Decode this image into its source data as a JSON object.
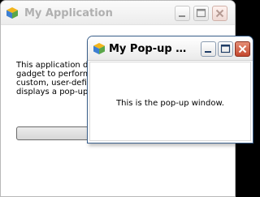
{
  "main_window": {
    "title": "My Application",
    "description": "This application de\ngadget to perform\ncustom, user-defin\ndisplays a pop-up",
    "controls": {
      "minimize": "minimize-icon",
      "maximize": "maximize-icon",
      "close": "close-icon"
    },
    "icon": "app-cube-icon"
  },
  "popup_window": {
    "title": "My Pop-up Wi...",
    "message": "This is the pop-up window.",
    "controls": {
      "minimize": "minimize-icon",
      "maximize": "maximize-icon",
      "close": "close-icon"
    },
    "icon": "app-cube-icon"
  },
  "colors": {
    "background": "#000000",
    "close_active": "#c4482e",
    "active_border": "#3a5f8a",
    "inactive_title_text": "#b0b0b0"
  }
}
